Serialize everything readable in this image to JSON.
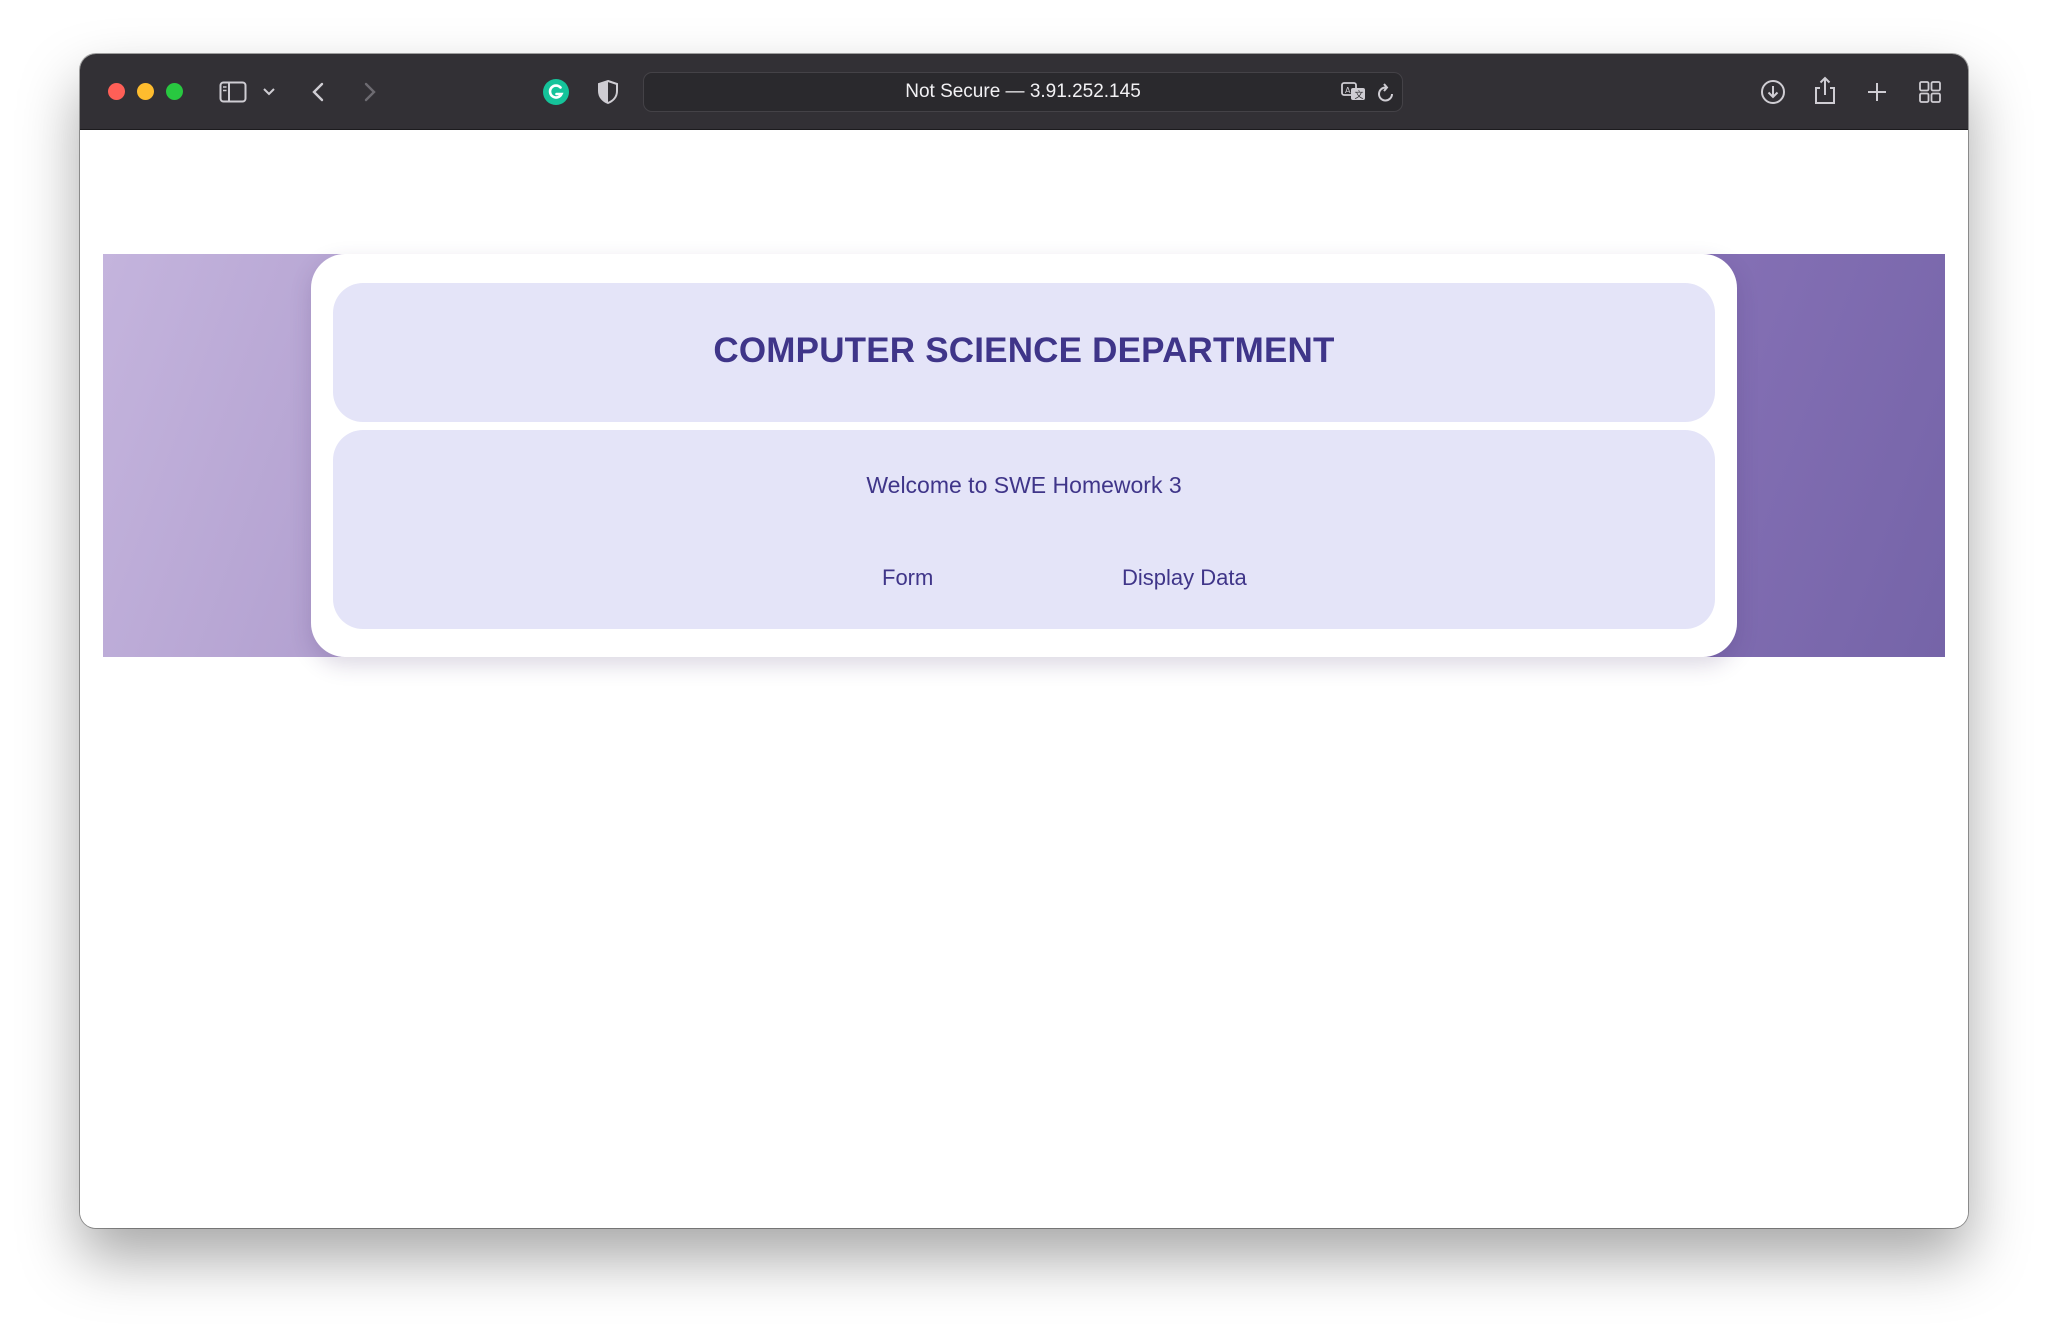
{
  "browser": {
    "address_text": "Not Secure — 3.91.252.145",
    "icons": [
      "sidebar-icon",
      "chevron-down-icon",
      "back-icon",
      "forward-icon",
      "grammarly-icon",
      "privacy-shield-icon",
      "translate-icon",
      "reload-icon",
      "download-icon",
      "share-icon",
      "new-tab-icon",
      "tab-overview-icon"
    ]
  },
  "page": {
    "title": "COMPUTER SCIENCE DEPARTMENT",
    "welcome": "Welcome to SWE Homework 3",
    "nav": {
      "form_label": "Form",
      "display_label": "Display Data"
    }
  },
  "colors": {
    "accent_text": "#3f3589",
    "panel_bg": "#e4e4f8",
    "banner_light": "#c4b4dd",
    "banner_dark": "#7564a8",
    "toolbar_bg": "#323035"
  }
}
